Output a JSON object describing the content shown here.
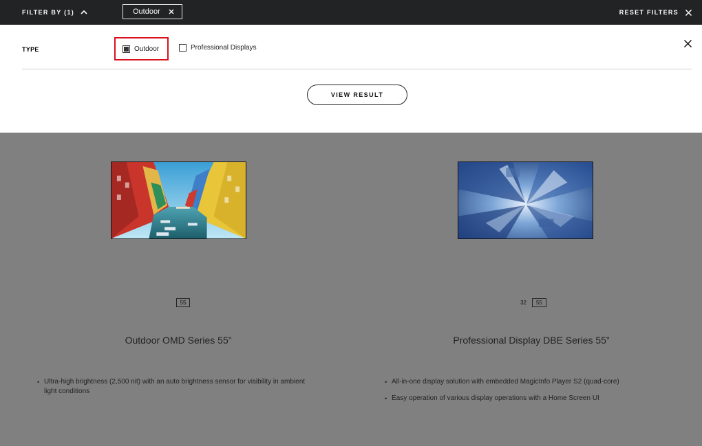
{
  "filter_bar": {
    "filter_by_label": "FILTER BY (1)",
    "chip_label": "Outdoor",
    "reset_label": "RESET FILTERS"
  },
  "filter_panel": {
    "type_label": "TYPE",
    "options": [
      {
        "label": "Outdoor",
        "checked": true
      },
      {
        "label": "Professional Displays",
        "checked": false
      }
    ],
    "view_result_label": "VIEW RESULT"
  },
  "products": [
    {
      "sizes": [
        "55"
      ],
      "selected_size": "55",
      "title": "Outdoor OMD Series 55”",
      "features": [
        "Ultra-high brightness (2,500 nit) with an auto brightness sensor for visibility in ambient light conditions"
      ]
    },
    {
      "sizes": [
        "32",
        "55"
      ],
      "selected_size": "55",
      "title": "Professional Display DBE Series 55”",
      "features": [
        "All-in-one display solution with embedded MagicInfo Player S2 (quad-core)",
        "Easy operation of various display operations with a Home Screen UI"
      ]
    }
  ],
  "icons": {
    "chevron": "chevron-up-icon",
    "close": "close-icon",
    "checkbox": "checkbox-icon"
  },
  "colors": {
    "top_bar": "#222325",
    "overlay": "#808080",
    "highlight": "#d9101b"
  }
}
